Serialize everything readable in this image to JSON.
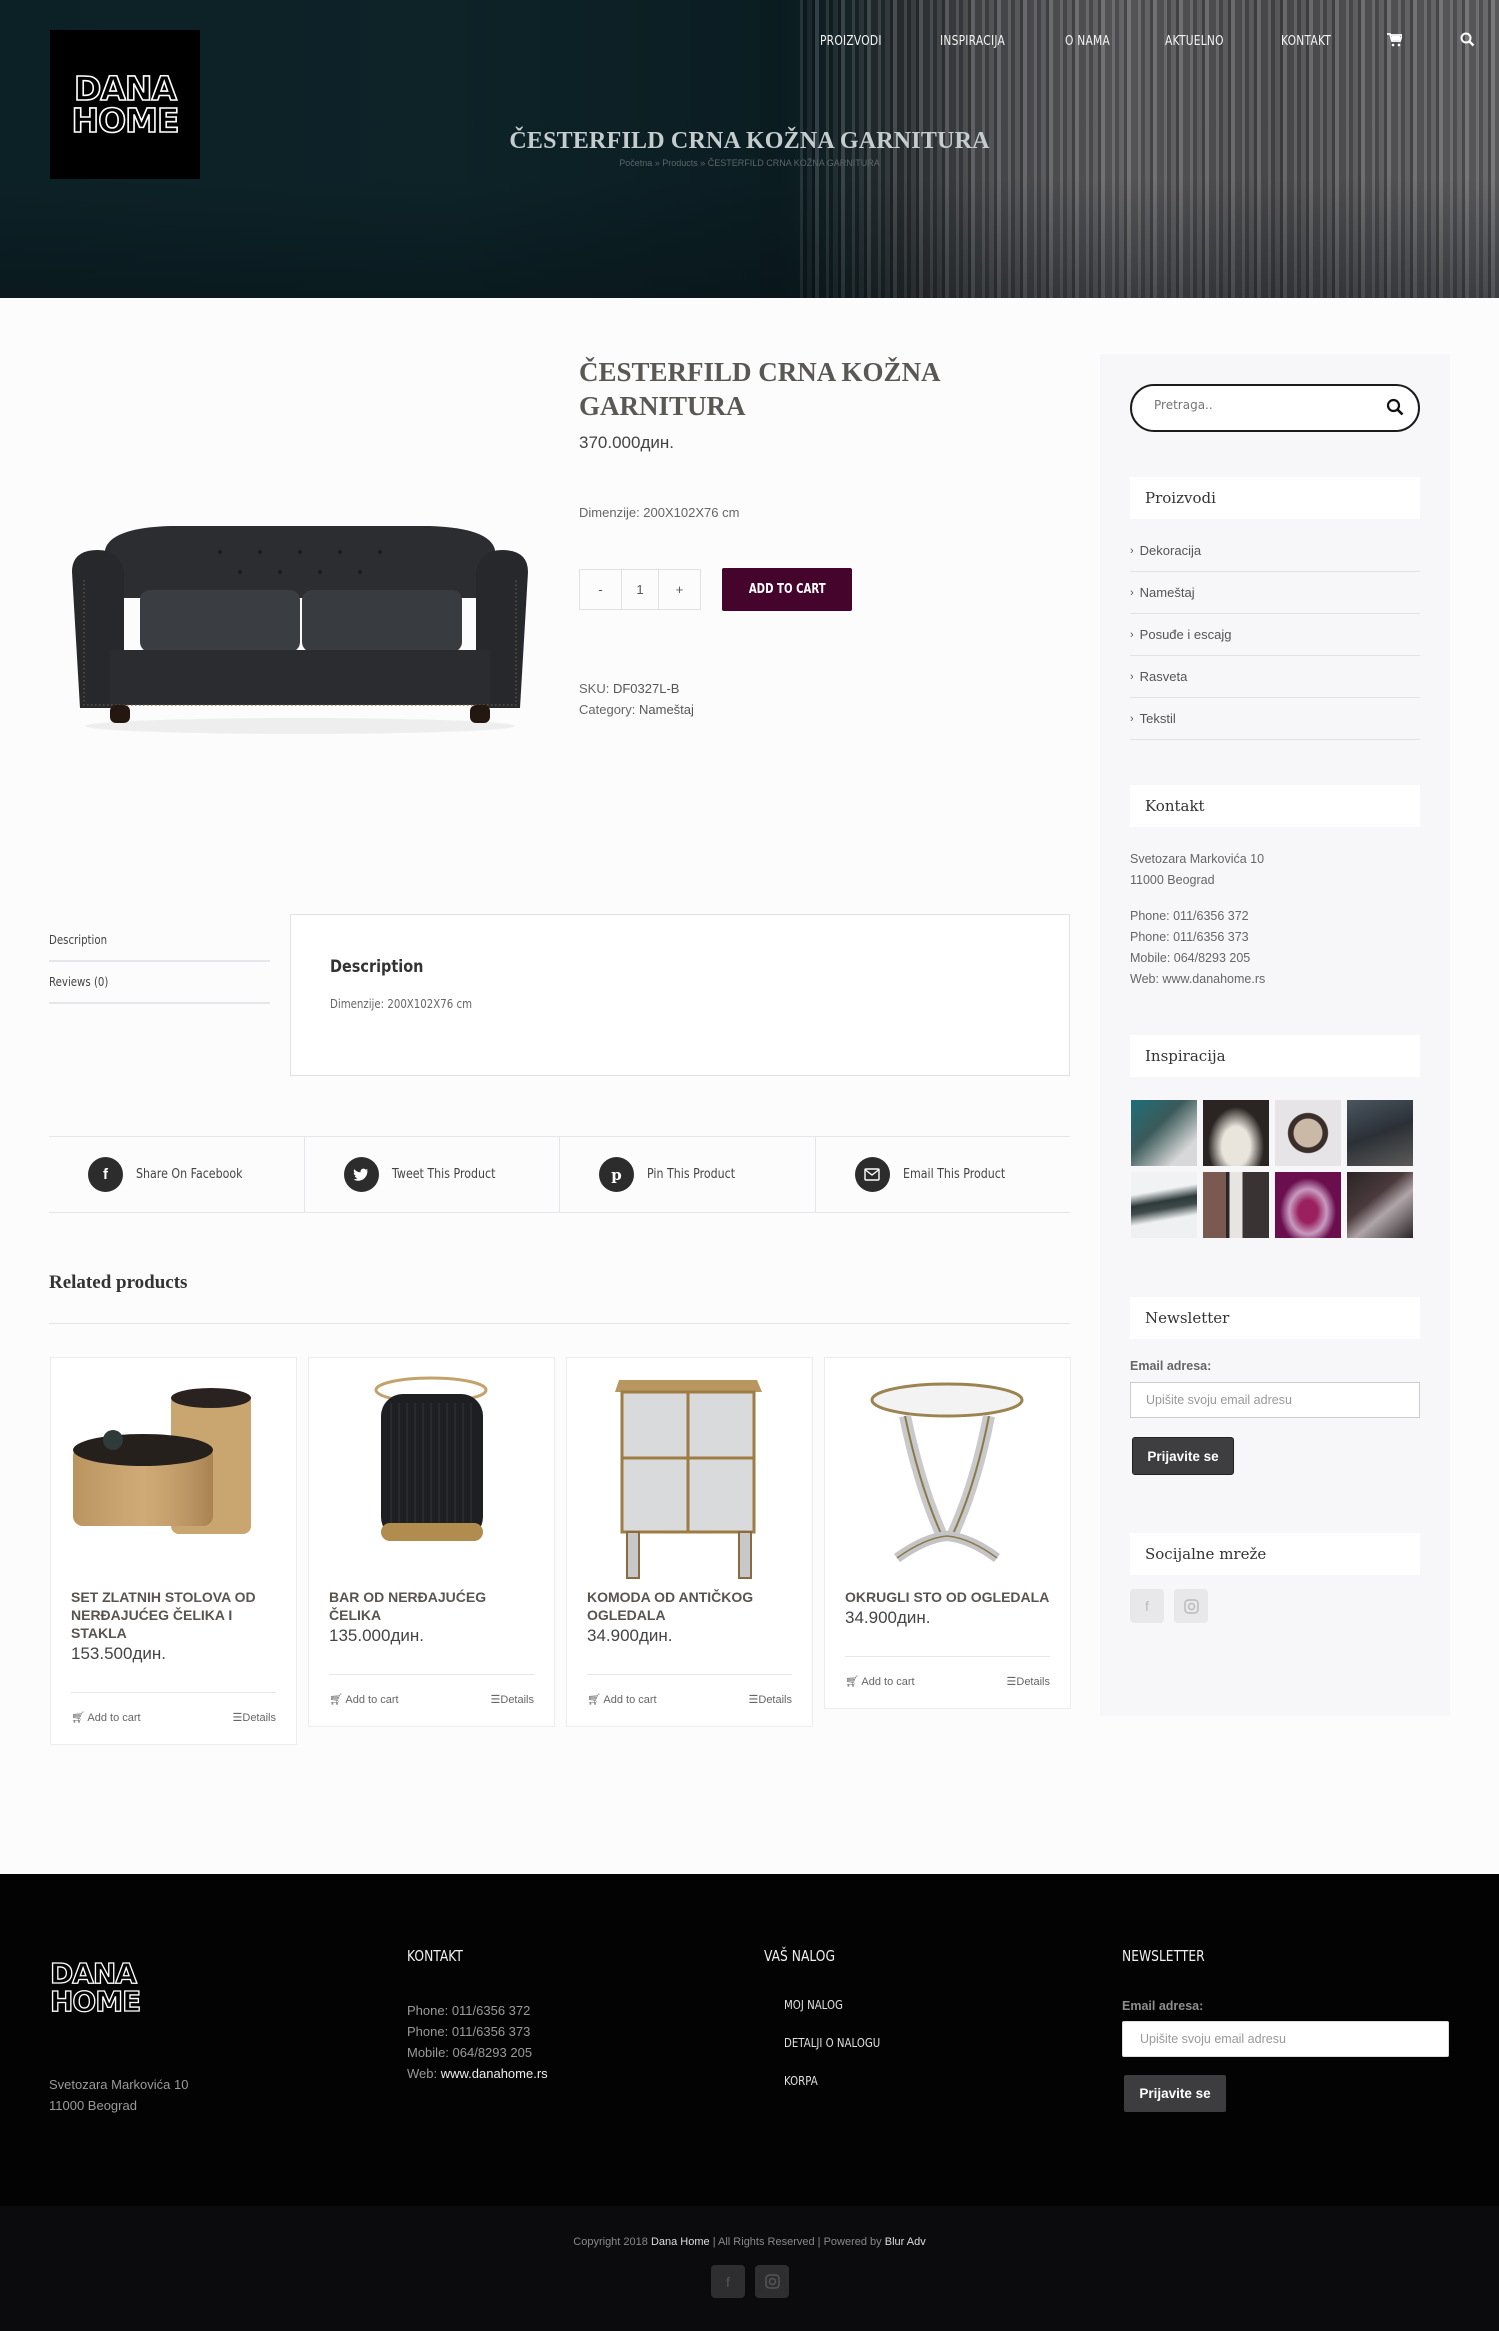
{
  "brand": {
    "logo_line1": "DANA",
    "logo_line2": "HOME"
  },
  "nav": {
    "items": [
      "PROIZVODI",
      "INSPIRACIJA",
      "O NAMA",
      "AKTUELNO",
      "KONTAKT"
    ],
    "cart_icon": "cart-icon",
    "search_icon": "search-icon"
  },
  "hero": {
    "title": "ČESTERFILD CRNA KOŽNA GARNITURA",
    "breadcrumb": "Početna » Products » ČESTERFILD CRNA KOŽNA GARNITURA"
  },
  "product": {
    "title": "ČESTERFILD CRNA KOŽNA GARNITURA",
    "price": "370.000дин.",
    "short_description": "Dimenzije: 200X102X76 cm",
    "quantity": "1",
    "minus_label": "-",
    "plus_label": "+",
    "add_to_cart": "ADD TO CART",
    "sku_label": "SKU:",
    "sku": "DF0327L-B",
    "category_label": "Category:",
    "category": "Nameštaj",
    "accent_color": "#45042b"
  },
  "tabs": {
    "items": [
      "Description",
      "Reviews (0)"
    ],
    "panel_title": "Description",
    "panel_text": "Dimenzije: 200X102X76 cm"
  },
  "share": [
    {
      "icon": "facebook-icon",
      "glyph": "f",
      "label": "Share On Facebook"
    },
    {
      "icon": "twitter-icon",
      "glyph": "t",
      "label": "Tweet This Product"
    },
    {
      "icon": "pinterest-icon",
      "glyph": "p",
      "label": "Pin This Product"
    },
    {
      "icon": "email-icon",
      "glyph": "✉",
      "label": "Email This Product"
    }
  ],
  "related": {
    "title": "Related products",
    "add_to_cart": "Add to cart",
    "details": "Details",
    "products": [
      {
        "name": "SET ZLATNIH STOLOVA OD NERĐAJUĆEG ČELIKA I STAKLA",
        "price": "153.500дин."
      },
      {
        "name": "BAR OD NERĐAJUĆEG ČELIKA",
        "price": "135.000дин."
      },
      {
        "name": "KOMODA OD ANTIČKOG OGLEDALA",
        "price": "34.900дин."
      },
      {
        "name": "OKRUGLI STO OD OGLEDALA",
        "price": "34.900дин."
      }
    ]
  },
  "sidebar": {
    "search_placeholder": "Pretraga..",
    "products_title": "Proizvodi",
    "categories": [
      "Dekoracija",
      "Nameštaj",
      "Posuđe i escajg",
      "Rasveta",
      "Tekstil"
    ],
    "contact_title": "Kontakt",
    "address_line1": "Svetozara Markovića 10",
    "address_line2": "11000 Beograd",
    "phone1": "Phone: 011/6356 372",
    "phone2": "Phone: 011/6356 373",
    "mobile": "Mobile: 064/8293 205",
    "web": "Web: www.danahome.rs",
    "inspiration_title": "Inspiracija",
    "newsletter_title": "Newsletter",
    "email_label": "Email adresa:",
    "email_placeholder": "Upišite svoju email adresu",
    "subscribe": "Prijavite se",
    "social_title": "Socijalne mreže"
  },
  "footer": {
    "address_line1": "Svetozara Markovića 10",
    "address_line2": "11000 Beograd",
    "contact_title": "KONTAKT",
    "phone1": "Phone: 011/6356 372",
    "phone2": "Phone: 011/6356 373",
    "mobile": "Mobile: 064/8293 205",
    "web_label": "Web: ",
    "web": "www.danahome.rs",
    "account_title": "VAŠ NALOG",
    "account_links": [
      "MOJ NALOG",
      "DETALJI O NALOGU",
      "KORPA"
    ],
    "newsletter_title": "NEWSLETTER",
    "email_label": "Email adresa:",
    "email_placeholder": "Upišite svoju email adresu",
    "subscribe": "Prijavite se",
    "copyright_prefix": "Copyright 2018 ",
    "copyright_brand": "Dana Home",
    "copyright_middle": " | All Rights Reserved | Powered by ",
    "copyright_agency": "Blur Adv"
  }
}
